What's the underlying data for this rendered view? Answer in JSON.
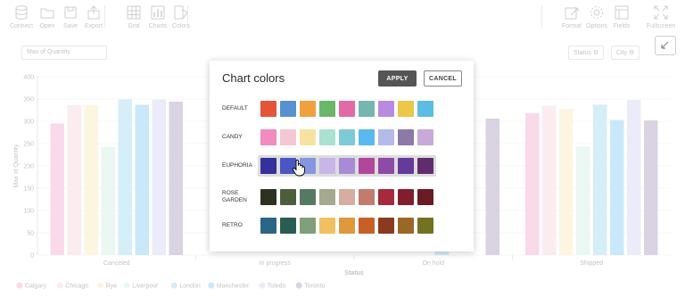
{
  "toolbar": {
    "items": [
      {
        "label": "Connect",
        "icon": "database-icon"
      },
      {
        "label": "Open",
        "icon": "folder-icon"
      },
      {
        "label": "Save",
        "icon": "save-icon"
      },
      {
        "label": "Export",
        "icon": "export-icon"
      },
      {
        "label": "Grid",
        "icon": "grid-icon"
      },
      {
        "label": "Charts",
        "icon": "charts-icon"
      },
      {
        "label": "Colors",
        "icon": "colors-icon"
      },
      {
        "label": "Format",
        "icon": "format-icon"
      },
      {
        "label": "Options",
        "icon": "gear-icon"
      },
      {
        "label": "Fields",
        "icon": "fields-icon"
      },
      {
        "label": "Fullscreen",
        "icon": "fullscreen-icon"
      }
    ]
  },
  "grid": {
    "measure": "Max of Quantity",
    "filters": [
      "Status",
      "City"
    ],
    "ylabel": "Max of Quantity",
    "xlabel": "Status"
  },
  "chart_data": {
    "type": "bar",
    "categories": [
      "Canceled",
      "In progress",
      "On hold",
      "Shipped"
    ],
    "ylim": [
      0,
      400
    ],
    "yticks": [
      0,
      50,
      100,
      150,
      200,
      250,
      300,
      350,
      400
    ],
    "series": [
      {
        "name": "Calgary",
        "color": "#f28bbf",
        "values": [
          295,
          null,
          null,
          318
        ]
      },
      {
        "name": "Chicago",
        "color": "#f3c7d3",
        "values": [
          336,
          null,
          null,
          335
        ]
      },
      {
        "name": "Rye",
        "color": "#f7e3a1",
        "values": [
          336,
          null,
          null,
          328
        ]
      },
      {
        "name": "Liverpool",
        "color": "#bfe9dd",
        "values": [
          242,
          null,
          null,
          243
        ]
      },
      {
        "name": "London",
        "color": "#7ecbe7",
        "values": [
          349,
          null,
          336,
          337
        ]
      },
      {
        "name": "Manchester",
        "color": "#59b9f0",
        "values": [
          337,
          null,
          null,
          303
        ]
      },
      {
        "name": "Toledo",
        "color": "#c3c4ee",
        "values": [
          349,
          null,
          null,
          348
        ]
      },
      {
        "name": "Toronto",
        "color": "#8b7aa8",
        "values": [
          344,
          null,
          306,
          302
        ]
      }
    ],
    "xlabel": "Status",
    "ylabel": "Max of Quantity",
    "grid": true,
    "legend": "bottom"
  },
  "dialog": {
    "title": "Chart colors",
    "apply_label": "APPLY",
    "cancel_label": "CANCEL",
    "palettes": [
      {
        "name": "DEFAULT",
        "colors": [
          "#e4543a",
          "#5891d0",
          "#f0a03e",
          "#6ab76a",
          "#e26aa6",
          "#77b5b1",
          "#b88be0",
          "#edc64a",
          "#5bbde4"
        ]
      },
      {
        "name": "CANDY",
        "colors": [
          "#f28bbf",
          "#f3c7d3",
          "#f7e3a1",
          "#a9e2d1",
          "#7ccbd6",
          "#59b9f0",
          "#b4bbe8",
          "#8b7aa8",
          "#c9a9d8"
        ]
      },
      {
        "name": "EUPHORIA",
        "colors": [
          "#35309a",
          "#4a56c4",
          "#8797df",
          "#c7b6e6",
          "#a88bd6",
          "#b0479d",
          "#8e4aa7",
          "#643a9a",
          "#5f2d6d"
        ]
      },
      {
        "name": "ROSE GARDEN",
        "colors": [
          "#2b3320",
          "#4c5e3b",
          "#557a62",
          "#a5a98d",
          "#d6ada1",
          "#c37b70",
          "#a52a3b",
          "#801f2b",
          "#6b1b22"
        ]
      },
      {
        "name": "RETRO",
        "colors": [
          "#2b6685",
          "#2b5c52",
          "#7fa07a",
          "#f1c160",
          "#e0983c",
          "#c75f27",
          "#8a3a1e",
          "#9b6727",
          "#737220"
        ]
      }
    ],
    "selected_palette": "EUPHORIA"
  },
  "legend": {
    "items": [
      "Calgary",
      "Chicago",
      "Rye",
      "Liverpool",
      "London",
      "Manchester",
      "Toledo",
      "Toronto"
    ]
  }
}
